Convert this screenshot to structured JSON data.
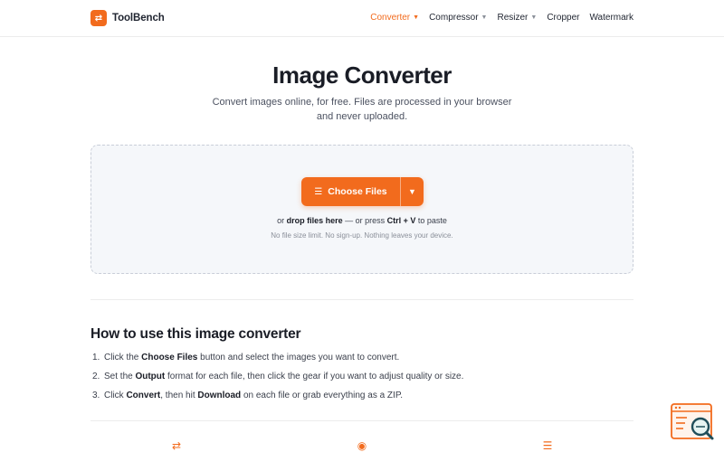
{
  "brand": {
    "name": "ToolBench"
  },
  "nav": [
    {
      "label": "Converter",
      "dropdown": true,
      "active": true
    },
    {
      "label": "Compressor",
      "dropdown": true,
      "active": false
    },
    {
      "label": "Resizer",
      "dropdown": true,
      "active": false
    },
    {
      "label": "Cropper",
      "dropdown": false,
      "active": false
    },
    {
      "label": "Watermark",
      "dropdown": false,
      "active": false
    }
  ],
  "hero": {
    "title": "Image Converter",
    "subtitle": "Convert images online, for free. Files are processed in your browser and never uploaded."
  },
  "upload": {
    "button_label": "Choose Files",
    "hint_prefix": "or ",
    "hint_drop": "drop files here",
    "hint_middle": " — or press ",
    "hint_shortcut": "Ctrl + V",
    "hint_suffix": " to paste",
    "note": "No file size limit. No sign-up. Nothing leaves your device."
  },
  "howto": {
    "title": "How to use this image converter",
    "steps": [
      {
        "num": "1.",
        "pre": "Click the ",
        "bold": "Choose Files",
        "post": " button and select the images you want to convert."
      },
      {
        "num": "2.",
        "pre": "Set the ",
        "bold": "Output",
        "post": " format for each file, then click the gear if you want to adjust quality or size."
      },
      {
        "num": "3.",
        "pre": "Click ",
        "bold": "Convert",
        "mid": ", then hit ",
        "bold2": "Download",
        "post": " on each file or grab everything as a ZIP."
      }
    ]
  },
  "colors": {
    "accent": "#f26b1d",
    "dropzone_bg": "#f5f7fa",
    "text": "#1f2430"
  },
  "icons": {
    "logo": "swap-arrows-icon",
    "upload_button": "file-list-icon",
    "features": [
      "swap-arrows-icon",
      "target-icon",
      "list-icon"
    ],
    "widget": "browser-search-icon"
  }
}
